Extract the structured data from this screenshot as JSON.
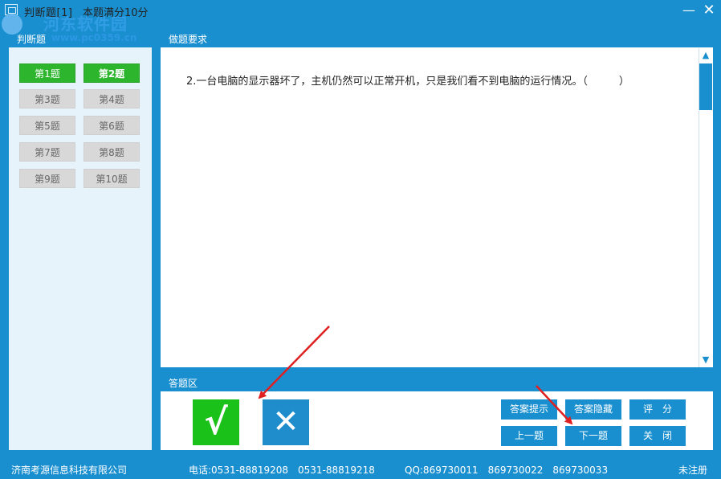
{
  "window": {
    "title": "判断题[1]",
    "score_info": "本题满分10分",
    "minimize_icon": "minimize-icon",
    "close_icon": "close-icon"
  },
  "watermark": {
    "text": "河东软件园",
    "url": "www.pc0359.cn"
  },
  "left_panel": {
    "header": "判断题",
    "questions": [
      {
        "label": "第1题",
        "state": "done"
      },
      {
        "label": "第2题",
        "state": "done"
      },
      {
        "label": "第3题",
        "state": "todo"
      },
      {
        "label": "第4题",
        "state": "todo"
      },
      {
        "label": "第5题",
        "state": "todo"
      },
      {
        "label": "第6题",
        "state": "todo"
      },
      {
        "label": "第7题",
        "state": "todo"
      },
      {
        "label": "第8题",
        "state": "todo"
      },
      {
        "label": "第9题",
        "state": "todo"
      },
      {
        "label": "第10题",
        "state": "todo"
      }
    ]
  },
  "requirements": {
    "header": "做题要求",
    "question_text": "2.一台电脑的显示器坏了，主机仍然可以正常开机，只是我们看不到电脑的运行情况。（　　　）"
  },
  "answer_area": {
    "header": "答题区",
    "true_symbol": "√",
    "false_symbol": "✕",
    "buttons": {
      "hint": "答案提示",
      "hide": "答案隐藏",
      "score": "评　分",
      "prev": "上一题",
      "next": "下一题",
      "close": "关　闭"
    }
  },
  "status": {
    "company": "济南考源信息科技有限公司",
    "phone": "电话:0531-88819208　0531-88819218",
    "qq": "QQ:869730011　869730022　869730033",
    "registration": "未注册"
  },
  "colors": {
    "accent": "#1a8fd0",
    "done": "#2db52d",
    "true_button": "#19c119",
    "false_button": "#1f8dcc",
    "annotation_arrow": "#e02020"
  }
}
